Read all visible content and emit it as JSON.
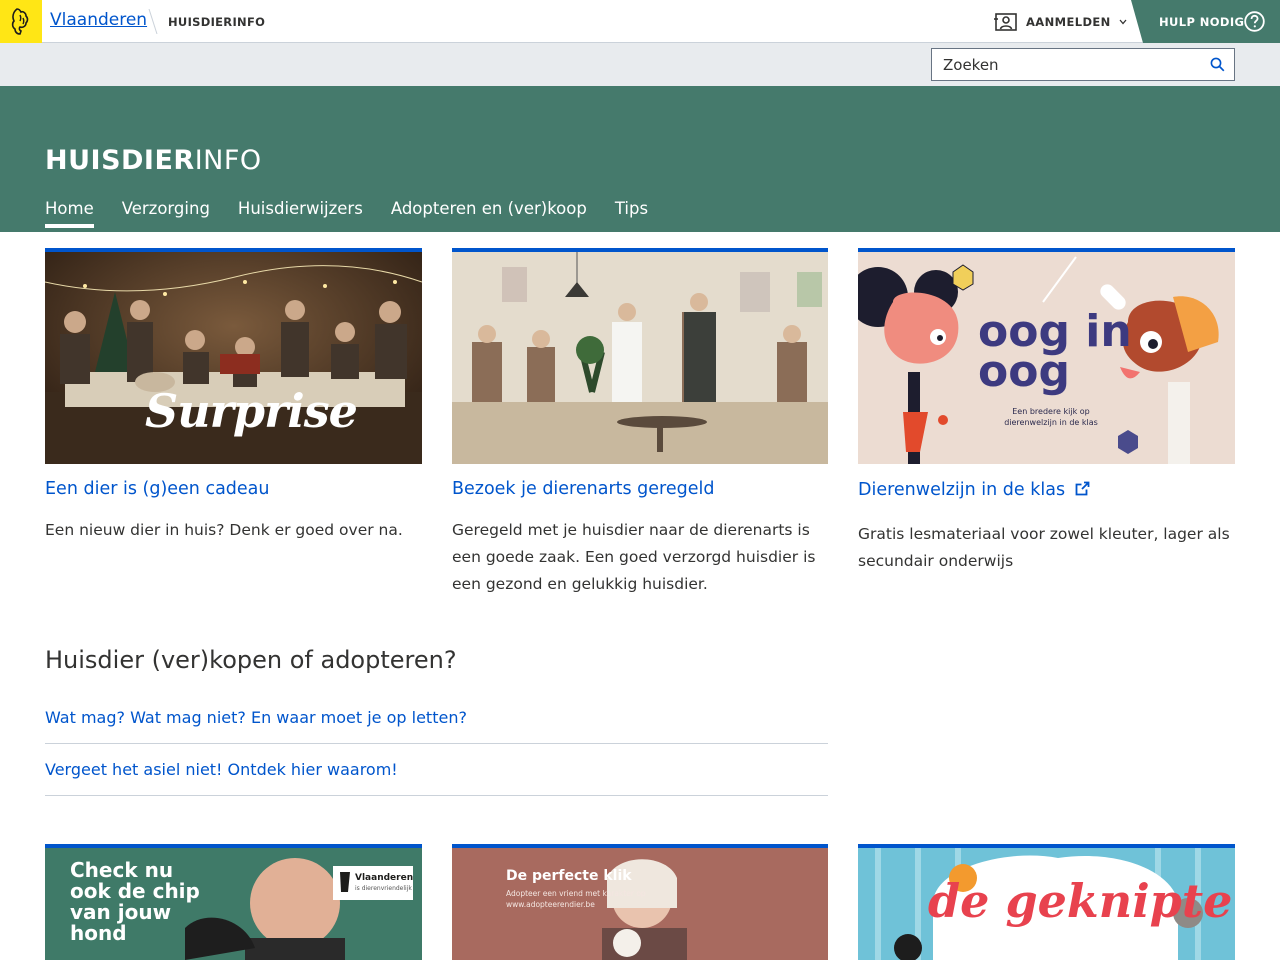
{
  "header": {
    "brand": "Vlaanderen",
    "site_sub": "HUISDIERINFO",
    "login_label": "AANMELDEN",
    "help_label": "HULP NODIG"
  },
  "search": {
    "placeholder": "Zoeken"
  },
  "site": {
    "title_bold": "HUISDIER",
    "title_light": "INFO"
  },
  "nav": {
    "items": [
      {
        "label": "Home",
        "active": true
      },
      {
        "label": "Verzorging"
      },
      {
        "label": "Huisdierwijzers"
      },
      {
        "label": "Adopteren en (ver)koop"
      },
      {
        "label": "Tips"
      }
    ]
  },
  "cards": [
    {
      "title": "Een dier is (g)een cadeau",
      "text": "Een nieuw dier in huis? Denk er goed over na.",
      "image_text": "Surprise"
    },
    {
      "title": "Bezoek je dierenarts geregeld",
      "text": "Geregeld met je huisdier naar de dierenarts is een goede zaak. Een goed verzorgd huisdier is een gezond en gelukkig huisdier."
    },
    {
      "title": "Dierenwelzijn in de klas",
      "text": "Gratis lesmateriaal voor zowel kleuter, lager als secundair onderwijs",
      "image_text_1": "oog in oog",
      "image_text_2": "Een bredere kijk op dierenwelzijn in de klas"
    }
  ],
  "section": {
    "title": "Huisdier (ver)kopen of adopteren?",
    "links": [
      "Wat mag? Wat mag niet? En waar moet je op letten?",
      "Vergeet het asiel niet! Ontdek hier waarom!"
    ]
  },
  "promo_cards": [
    {
      "image_text": "Check nu ook de chip van jouw hond",
      "badge": "Vlaanderen",
      "badge_sub": "is dierenvriendelijk"
    },
    {
      "image_text": "De perfecte klik",
      "image_sub": "Adopteer een vriend met karakter op www.adopteerendier.be"
    },
    {
      "image_text": "de geknipte"
    }
  ],
  "colors": {
    "brand_green": "#457a6c",
    "link_blue": "#0055cc",
    "flag_yellow": "#ffe615"
  }
}
